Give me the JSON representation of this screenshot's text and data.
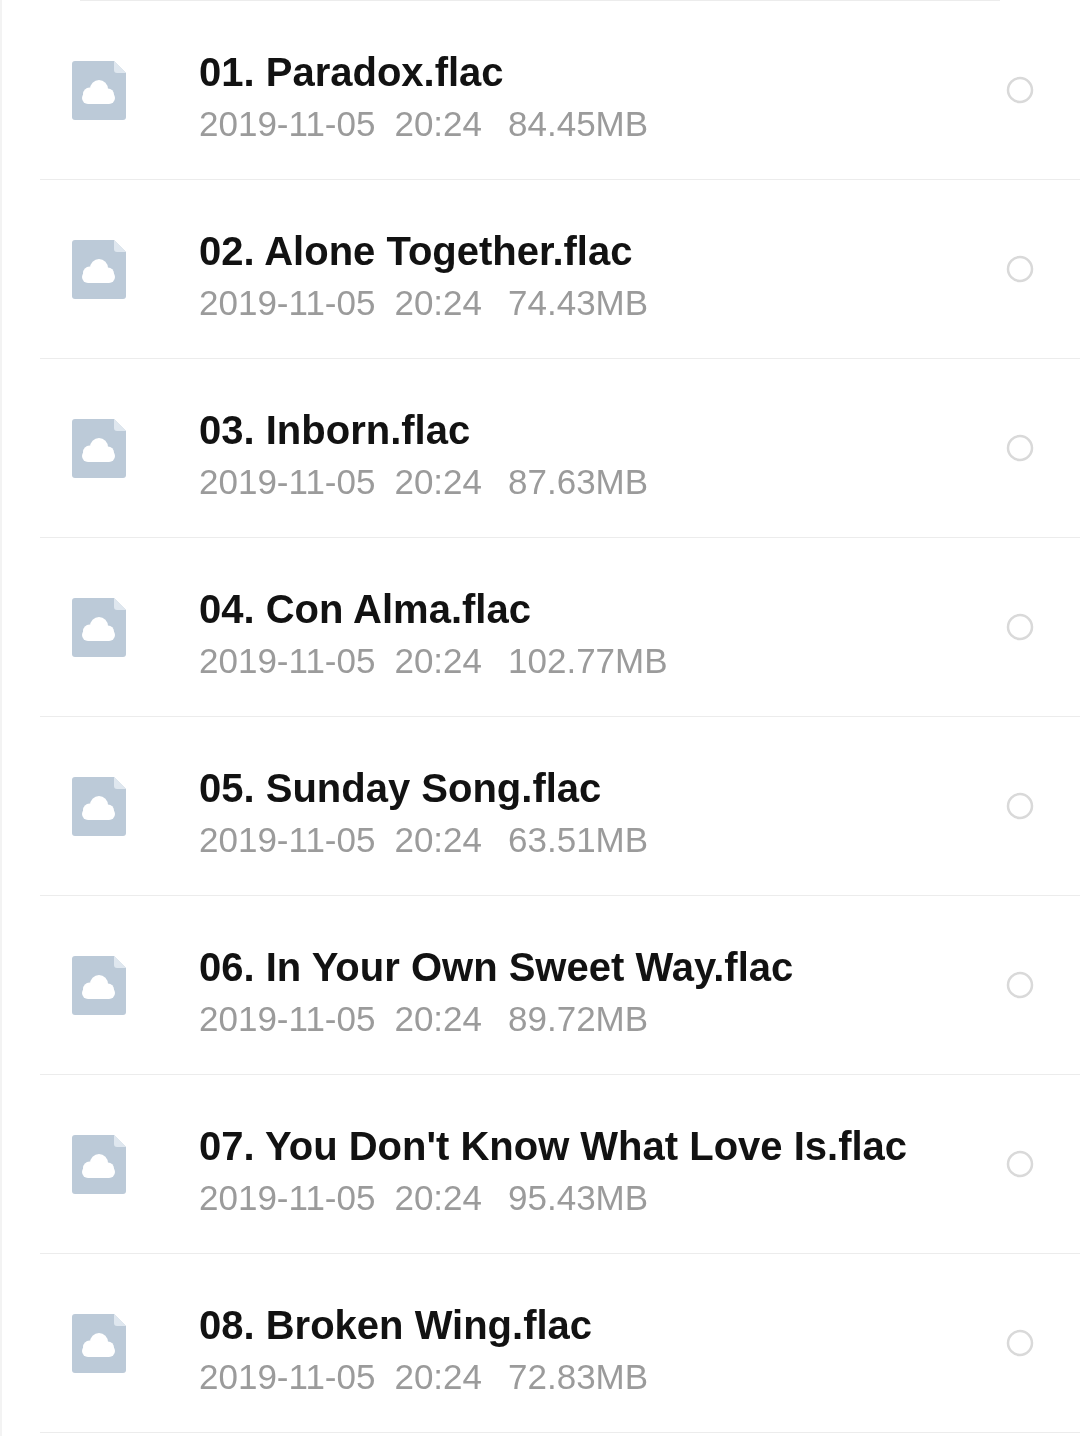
{
  "files": [
    {
      "name": "01. Paradox.flac",
      "date": "2019-11-05",
      "time": "20:24",
      "size": "84.45MB",
      "selected": false
    },
    {
      "name": "02. Alone Together.flac",
      "date": "2019-11-05",
      "time": "20:24",
      "size": "74.43MB",
      "selected": false
    },
    {
      "name": "03. Inborn.flac",
      "date": "2019-11-05",
      "time": "20:24",
      "size": "87.63MB",
      "selected": false
    },
    {
      "name": "04. Con Alma.flac",
      "date": "2019-11-05",
      "time": "20:24",
      "size": "102.77MB",
      "selected": false
    },
    {
      "name": "05. Sunday Song.flac",
      "date": "2019-11-05",
      "time": "20:24",
      "size": "63.51MB",
      "selected": false
    },
    {
      "name": "06. In Your Own Sweet Way.flac",
      "date": "2019-11-05",
      "time": "20:24",
      "size": "89.72MB",
      "selected": false
    },
    {
      "name": "07. You Don't Know What Love Is.flac",
      "date": "2019-11-05",
      "time": "20:24",
      "size": "95.43MB",
      "selected": false
    },
    {
      "name": "08. Broken Wing.flac",
      "date": "2019-11-05",
      "time": "20:24",
      "size": "72.83MB",
      "selected": false
    }
  ]
}
